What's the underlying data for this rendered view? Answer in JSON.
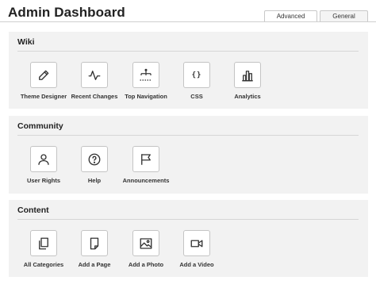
{
  "header": {
    "title": "Admin Dashboard",
    "tabs": [
      {
        "label": "Advanced",
        "active": true
      },
      {
        "label": "General",
        "active": false
      }
    ]
  },
  "sections": [
    {
      "title": "Wiki",
      "tools": [
        {
          "label": "Theme Designer",
          "icon": "pencil-icon"
        },
        {
          "label": "Recent Changes",
          "icon": "activity-pulse-icon"
        },
        {
          "label": "Top Navigation",
          "icon": "sitemap-icon"
        },
        {
          "label": "CSS",
          "icon": "curly-braces-icon"
        },
        {
          "label": "Analytics",
          "icon": "bar-chart-icon"
        }
      ]
    },
    {
      "title": "Community",
      "tools": [
        {
          "label": "User Rights",
          "icon": "user-icon"
        },
        {
          "label": "Help",
          "icon": "question-circle-icon"
        },
        {
          "label": "Announcements",
          "icon": "flag-icon"
        }
      ]
    },
    {
      "title": "Content",
      "tools": [
        {
          "label": "All Categories",
          "icon": "copy-pages-icon"
        },
        {
          "label": "Add a Page",
          "icon": "page-icon"
        },
        {
          "label": "Add a Photo",
          "icon": "photo-icon"
        },
        {
          "label": "Add a Video",
          "icon": "video-camera-icon"
        }
      ]
    }
  ],
  "css_glyph": "{}",
  "colors": {
    "section_bg": "#f2f2f2",
    "tile_border": "#c4c4c4",
    "text": "#222222"
  }
}
